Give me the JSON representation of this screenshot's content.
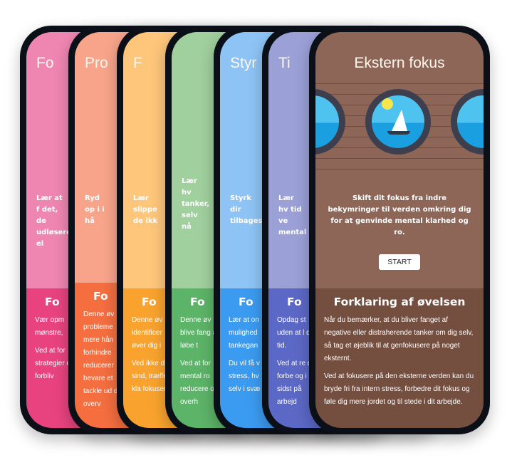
{
  "cards": [
    {
      "title": "Fo",
      "intro": "Lær at f det, de udløsere el",
      "heading": "Fo",
      "p1": "Vær opm mønstre,",
      "p2": "Ved at for strategier og forbliv",
      "top": "#ef86b1",
      "bottom": "#e8437f"
    },
    {
      "title": "Pro",
      "intro": "Ryd op i i hå",
      "heading": "Fo",
      "p1": "Denne øv probleme mere hån forhindre reducerer bevare et tackle ud dig overv",
      "p2": "",
      "top": "#f8a48b",
      "bottom": "#f46e40"
    },
    {
      "title": "F",
      "intro": "Lær slippe de ikk",
      "heading": "Fo",
      "p1": "Denne øv identificer øver dig i",
      "p2": "Ved ikke dit sind, træffe kla fokuseret",
      "top": "#fdc67b",
      "bottom": "#f9a32e"
    },
    {
      "title": "",
      "intro": "Lær hv tanker, selv nå",
      "heading": "Fo",
      "p1": "Denne øv blive fang at løbe t",
      "p2": "Ved at for mental ro reducere og overh",
      "top": "#a0d09d",
      "bottom": "#5cb468"
    },
    {
      "title": "Styr",
      "intro": "Styrk dir tilbages",
      "heading": "Fo",
      "p1": "Lær at on mulighed tankegan",
      "p2": "Du vil få v stress, hv selv i svæ",
      "top": "#8ec4f5",
      "bottom": "#3b9bf0"
    },
    {
      "title": "Ti",
      "intro": "Lær hv tid ve mental",
      "heading": "Fo",
      "p1": "Opdag st uden at l din tid.",
      "p2": "Ved at re du forbe og i sidst på arbejd",
      "top": "#9ba0d7",
      "bottom": "#5c68c6"
    },
    {
      "title": "Ekstern fokus",
      "intro": "Skift dit fokus fra indre bekymringer til verden omkring dig for at genvinde mental klarhed og ro.",
      "start": "START",
      "heading": "Forklaring af øvelsen",
      "p1": "Når du bemærker, at du bliver fanget af negative eller distraherende tanker om dig selv, så tag et øjeblik til at genfokusere på noget eksternt.",
      "p2": "Ved at fokusere på den eksterne verden kan du bryde fri fra intern stress, forbedre dit fokus og føle dig mere jordet og til stede i dit arbejde.",
      "top": "#8d6657",
      "bottom": "#744f40"
    }
  ]
}
